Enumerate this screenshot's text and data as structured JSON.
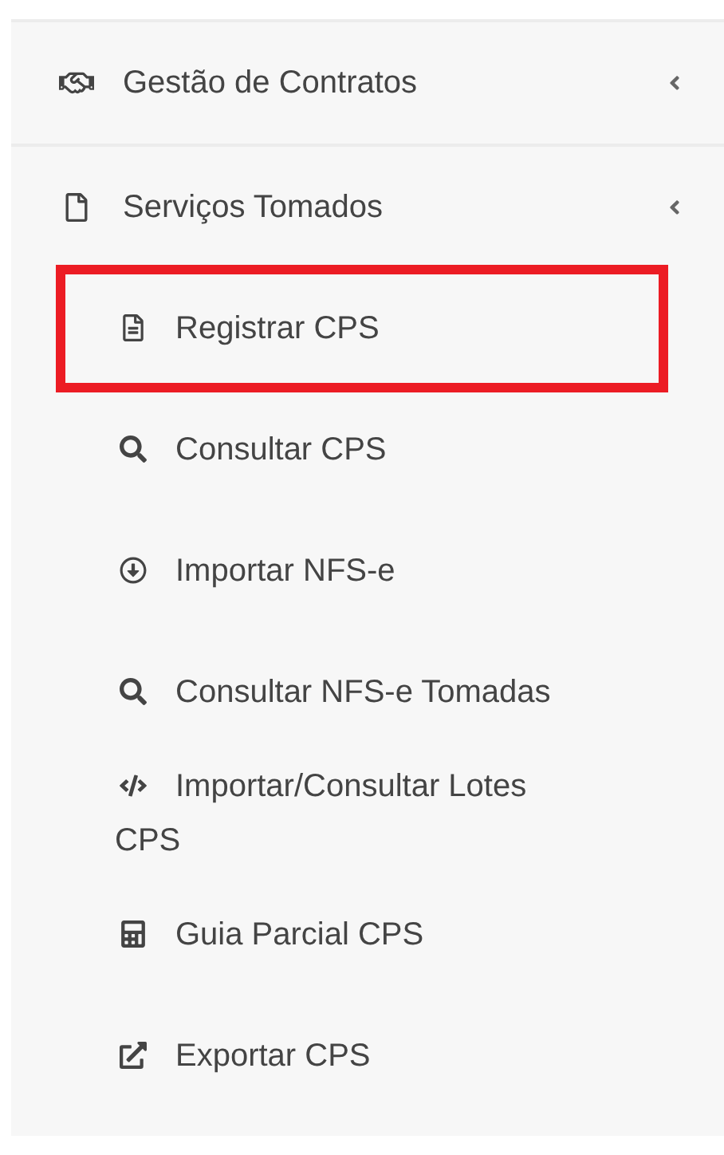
{
  "menu": [
    {
      "label": "Gestão de Contratos"
    },
    {
      "label": "Serviços Tomados",
      "children": [
        {
          "label": "Registrar CPS",
          "highlighted": true
        },
        {
          "label": "Consultar CPS",
          "highlighted": false
        },
        {
          "label": "Importar NFS-e",
          "highlighted": false
        },
        {
          "label": "Consultar NFS-e Tomadas",
          "highlighted": false
        },
        {
          "label": "Importar/Consultar Lotes CPS",
          "highlighted": false
        },
        {
          "label": "Guia Parcial CPS",
          "highlighted": false
        },
        {
          "label": "Exportar CPS",
          "highlighted": false
        }
      ]
    }
  ]
}
